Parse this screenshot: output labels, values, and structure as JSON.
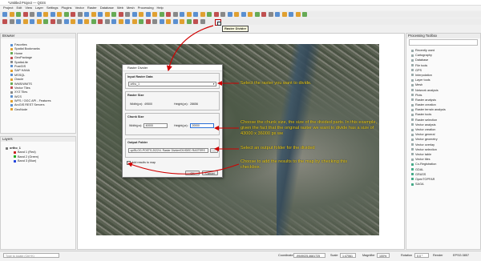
{
  "window": {
    "title": "*Untitled Project — QGIS"
  },
  "menu": [
    "Project",
    "Edit",
    "View",
    "Layer",
    "Settings",
    "Plugins",
    "Vector",
    "Raster",
    "Database",
    "Web",
    "Mesh",
    "Processing",
    "Help"
  ],
  "toolbar": {
    "tooltip": "Raster Divider"
  },
  "browser": {
    "title": "Browser",
    "items": [
      "Favorites",
      "Spatial Bookmarks",
      "Home",
      "GeoPackage",
      "SpatiaLite",
      "PostGIS",
      "SAP HANA",
      "MSSQL",
      "Oracle",
      "WMS/WMTS",
      "Vector Tiles",
      "XYZ Tiles",
      "WCS",
      "WFS / OGC API - Features",
      "ArcGIS REST Servers",
      "GeoNode"
    ]
  },
  "layers": {
    "title": "Layers",
    "items": [
      "ortho_1",
      "Band 1 (Red)",
      "Band 2 (Green)",
      "Band 3 (Blue)"
    ],
    "colors": [
      "#cc2222",
      "#22aa22",
      "#2244dd"
    ]
  },
  "toolbox": {
    "title": "Processing Toolbox",
    "items": [
      "Recently used",
      "Cartography",
      "Database",
      "File tools",
      "GPS",
      "Interpolation",
      "Layer tools",
      "Mesh",
      "Network analysis",
      "Plots",
      "Raster analysis",
      "Raster creation",
      "Raster terrain analysis",
      "Raster tools",
      "Raster selection",
      "Vector analysis",
      "Vector creation",
      "Vector general",
      "Vector geometry",
      "Vector overlay",
      "Vector selection",
      "Vector table",
      "Vector tiles",
      "Co-Registration",
      "GDAL",
      "GRASS",
      "OpenTOPFAR",
      "SAGA"
    ]
  },
  "dialog": {
    "title": "Raster Divider",
    "input_group": "Input Raster Data",
    "input_value": "ortho_1",
    "size_group": "Raster Size",
    "width_label": "Width(px):",
    "width_value": "49500",
    "height_label": "Height(px):",
    "height_value": "28656",
    "chunk_group": "Chunk Size",
    "chunk_width_label": "Width(px):",
    "chunk_width_value": "40000",
    "chunk_height_label": "Height(px):",
    "chunk_height_value": "20000",
    "output_group": "Output Folder",
    "output_path": "op/BLOG-POSTS-2022/4. Raster Divider/DIVIDED RASTERS",
    "browse_label": "...",
    "add_results_label": "Add results to map",
    "ok_label": "OK",
    "cancel_label": "Cancel"
  },
  "annotations": {
    "a1": "Select the raster you want to divide.",
    "a2": "Choose the chunk size, the size of the divided parts. In this example, given the fact that the original raster we want to divide has a size of 43000 x 36000 px we",
    "a3": "Select an output folder for the divided",
    "a4": "Choose to add the results to the map by checking this checkbox."
  },
  "status": {
    "search_placeholder": "Type to locate (Ctrl+K)",
    "coordinate_label": "Coordinate",
    "coordinate_value": "-9949025,4681725",
    "scale_label": "Scale",
    "scale_value": "1:47061",
    "magnifier_label": "Magnifier",
    "magnifier_value": "100%",
    "rotation_label": "Rotation",
    "rotation_value": "0.0 °",
    "render_label": "Render",
    "crs_label": "EPSG:3857"
  },
  "colors": {
    "accent": "#c00000",
    "annotation": "#f2d21a"
  }
}
